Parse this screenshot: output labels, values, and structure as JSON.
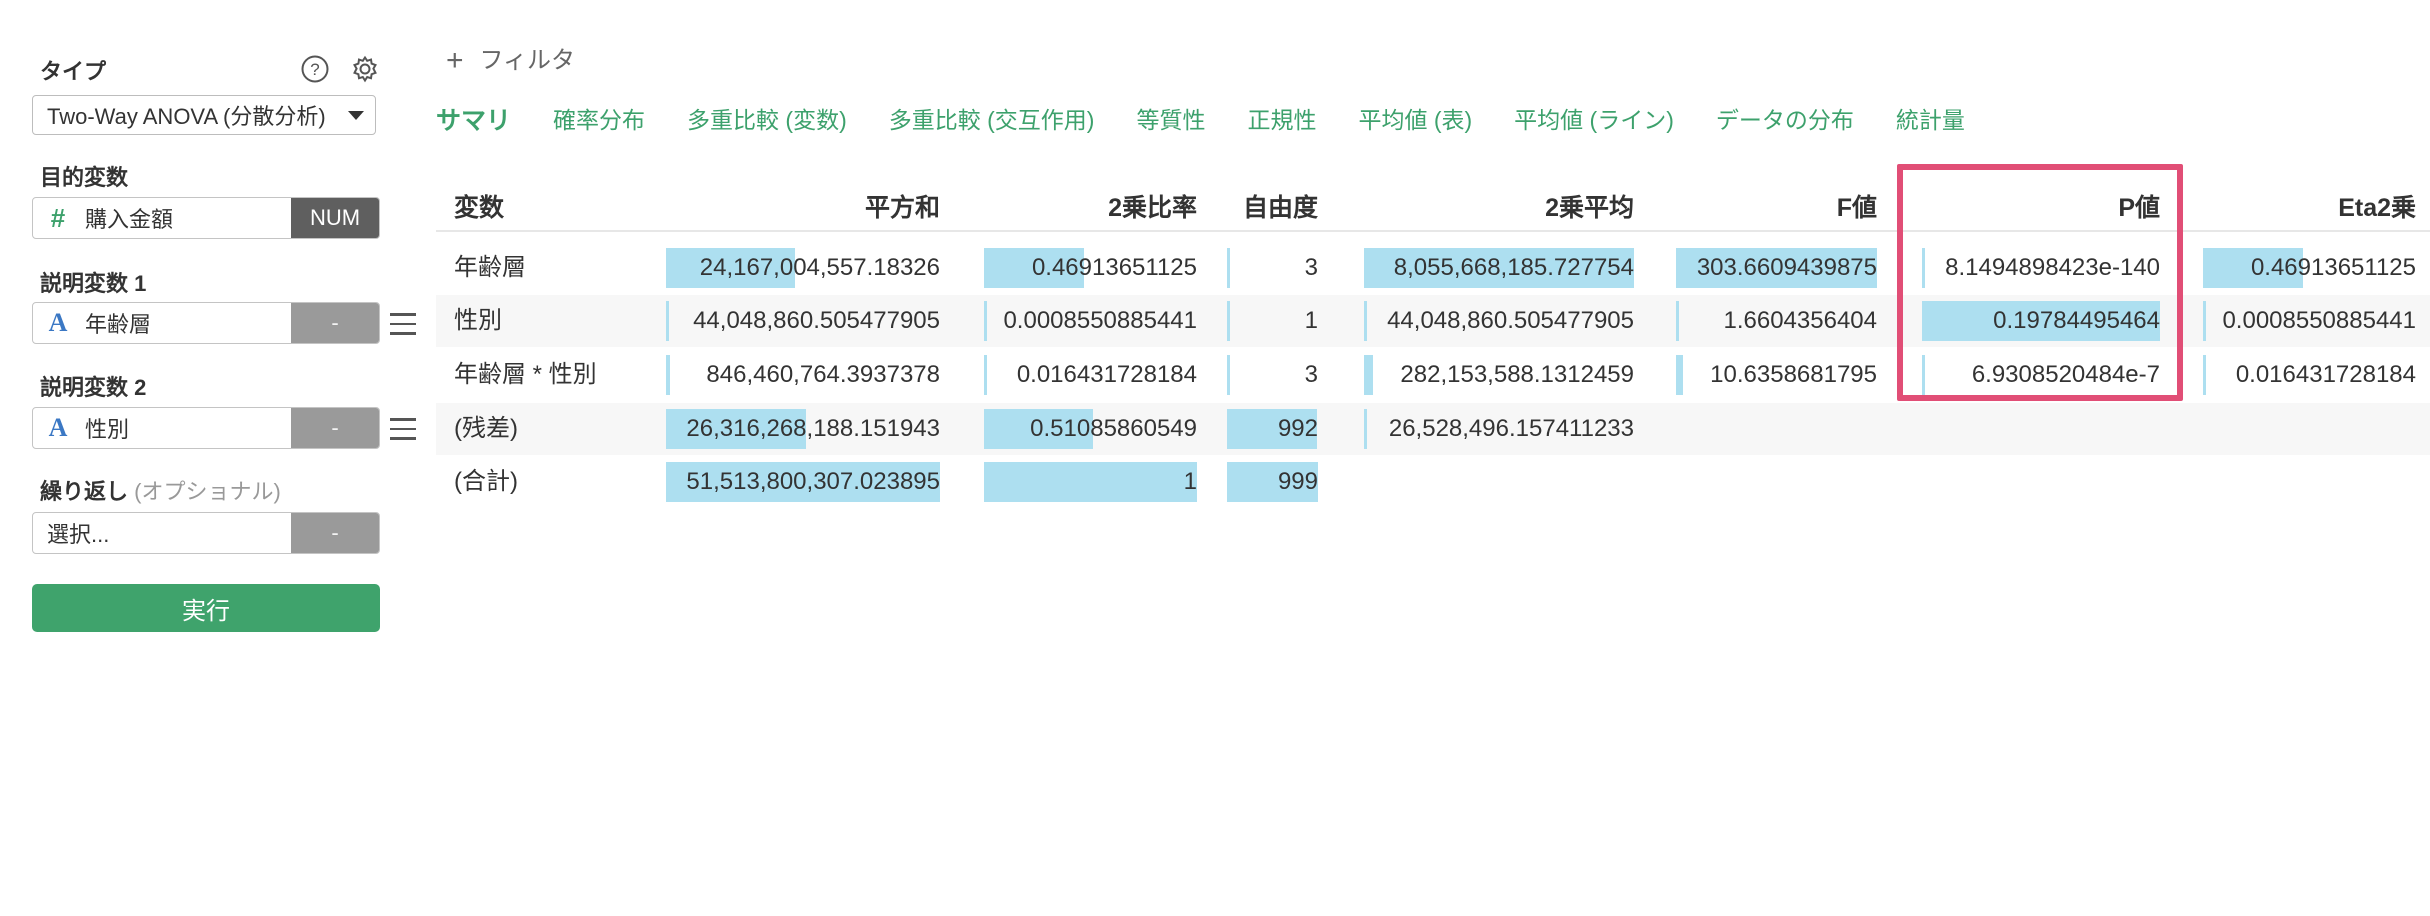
{
  "sidebar": {
    "type_label": "タイプ",
    "type_value": "Two-Way ANOVA (分散分析)",
    "target_label": "目的変数",
    "target_var": {
      "icon": "#",
      "name": "購入金額",
      "tag": "NUM"
    },
    "exp1_label": "説明変数 1",
    "exp1_var": {
      "icon": "A",
      "name": "年齢層",
      "tag": "-"
    },
    "exp2_label": "説明変数 2",
    "exp2_var": {
      "icon": "A",
      "name": "性別",
      "tag": "-"
    },
    "repeat_label": "繰り返し",
    "repeat_optional": "(オプショナル)",
    "repeat_var": {
      "placeholder": "選択...",
      "tag": "-"
    },
    "run_label": "実行",
    "help_icon": "help-circle-icon",
    "settings_icon": "gear-icon"
  },
  "toolbar": {
    "filter_icon": "+",
    "filter_label": "フィルタ"
  },
  "tabs": [
    "サマリ",
    "確率分布",
    "多重比較 (変数)",
    "多重比較 (交互作用)",
    "等質性",
    "正規性",
    "平均値 (表)",
    "平均値 (ライン)",
    "データの分布",
    "統計量"
  ],
  "active_tab": 0,
  "table": {
    "headers": [
      "変数",
      "平方和",
      "2乗比率",
      "自由度",
      "2乗平均",
      "F値",
      "P値",
      "Eta2乗"
    ],
    "rows": [
      [
        "年齢層",
        "24,167,004,557.18326",
        "0.46913651125",
        "3",
        "8,055,668,185.727754",
        "303.6609439875",
        "8.1494898423e-140",
        "0.46913651125"
      ],
      [
        "性別",
        "44,048,860.505477905",
        "0.0008550885441",
        "1",
        "44,048,860.505477905",
        "1.6604356404",
        "0.19784495464",
        "0.0008550885441"
      ],
      [
        "年齢層 * 性別",
        "846,460,764.3937378",
        "0.016431728184",
        "3",
        "282,153,588.1312459",
        "10.6358681795",
        "6.9308520484e-7",
        "0.016431728184"
      ],
      [
        "(残差)",
        "26,316,268,188.151943",
        "0.51085860549",
        "992",
        "26,528,496.157411233",
        "",
        "",
        ""
      ],
      [
        "(合計)",
        "51,513,800,307.023895",
        "1",
        "999",
        "",
        "",
        "",
        ""
      ]
    ],
    "bar_fractions": [
      [
        null,
        0.469,
        0.469,
        0.003,
        1.0,
        1.0,
        0.0,
        0.469
      ],
      [
        null,
        0.001,
        0.001,
        0.001,
        0.005,
        0.005,
        1.0,
        0.001
      ],
      [
        null,
        0.016,
        0.016,
        0.003,
        0.035,
        0.035,
        0.0,
        0.016
      ],
      [
        null,
        0.511,
        0.511,
        0.993,
        0.003,
        null,
        null,
        null
      ],
      [
        null,
        1.0,
        1.0,
        1.0,
        null,
        null,
        null,
        null
      ]
    ],
    "highlighted_column": "P値",
    "bar_color": "#addff0",
    "highlight_color": "#e14e76"
  }
}
